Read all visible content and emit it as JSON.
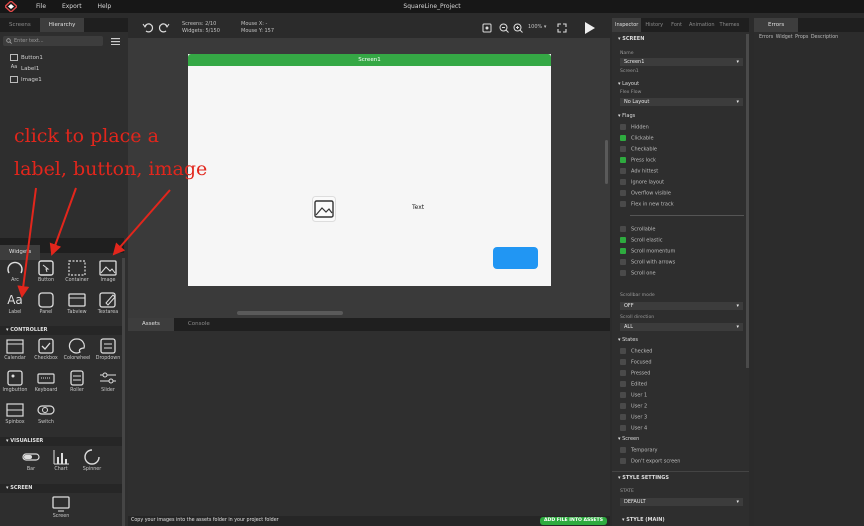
{
  "titlebar": {
    "menu": [
      "File",
      "Export",
      "Help"
    ],
    "title": "SquareLine_Project"
  },
  "left_tabs": [
    "Screens",
    "Hierarchy"
  ],
  "search": {
    "placeholder": "Enter text..."
  },
  "hierarchy": [
    {
      "icon": "button-icon",
      "label": "Button1"
    },
    {
      "icon": "label-icon",
      "label": "Label1"
    },
    {
      "icon": "image-icon",
      "label": "Image1"
    }
  ],
  "widgets_tab": "Widgets",
  "widgets_basic": [
    {
      "icon": "arc-icon",
      "label": "Arc"
    },
    {
      "icon": "button-icon",
      "label": "Button"
    },
    {
      "icon": "container-icon",
      "label": "Container"
    },
    {
      "icon": "image-icon",
      "label": "Image"
    },
    {
      "icon": "label-icon",
      "label": "Label"
    },
    {
      "icon": "panel-icon",
      "label": "Panel"
    },
    {
      "icon": "tabview-icon",
      "label": "Tabview"
    },
    {
      "icon": "textarea-icon",
      "label": "Textarea"
    }
  ],
  "section_controller": "CONTROLLER",
  "widgets_controller": [
    {
      "icon": "calendar-icon",
      "label": "Calendar"
    },
    {
      "icon": "checkbox-icon",
      "label": "Checkbox"
    },
    {
      "icon": "colorwheel-icon",
      "label": "Colorwheel"
    },
    {
      "icon": "dropdown-icon",
      "label": "Dropdown"
    },
    {
      "icon": "imgbutton-icon",
      "label": "Imgbutton"
    },
    {
      "icon": "keyboard-icon",
      "label": "Keyboard"
    },
    {
      "icon": "roller-icon",
      "label": "Roller"
    },
    {
      "icon": "slider-icon",
      "label": "Slider"
    },
    {
      "icon": "spinbox-icon",
      "label": "Spinbox"
    },
    {
      "icon": "switch-icon",
      "label": "Switch"
    }
  ],
  "section_visualiser": "VISUALISER",
  "widgets_visualiser": [
    {
      "icon": "bar-icon",
      "label": "Bar"
    },
    {
      "icon": "chart-icon",
      "label": "Chart"
    },
    {
      "icon": "spinner-icon",
      "label": "Spinner"
    }
  ],
  "section_screen": "SCREEN",
  "widgets_screen": [
    {
      "icon": "screen-icon",
      "label": "Screen"
    }
  ],
  "toolbar": {
    "screens": "Screens: 2/10",
    "widgets": "Widgets: 5/150",
    "mouse_x": "Mouse X: -",
    "mouse_y": "Mouse Y: 157",
    "zoom": "100%"
  },
  "canvas": {
    "screen_title": "Screen1",
    "label_text": "Text",
    "button_color": "#2196f3"
  },
  "bottom_tabs": [
    "Assets",
    "Console"
  ],
  "assets": {
    "hint": "Copy your images into the assets folder in your project folder",
    "add_button": "ADD FILE INTO ASSETS"
  },
  "inspector_tabs": [
    "Inspector",
    "History",
    "Font",
    "Animation",
    "Themes"
  ],
  "inspector": {
    "screen_head": "SCREEN",
    "name_label": "Name",
    "name_value": "Screen1",
    "name_sub": "Screen1",
    "layout_head": "Layout",
    "flex_flow_label": "Flex Flow",
    "flex_flow_value": "No Layout",
    "flags_head": "Flags",
    "flags": [
      {
        "label": "Hidden",
        "on": false
      },
      {
        "label": "Clickable",
        "on": true
      },
      {
        "label": "Checkable",
        "on": false
      },
      {
        "label": "Press lock",
        "on": true
      },
      {
        "label": "Adv hittest",
        "on": false
      },
      {
        "label": "Ignore layout",
        "on": false
      },
      {
        "label": "Overflow visible",
        "on": false
      },
      {
        "label": "Flex in new track",
        "on": false
      }
    ],
    "scroll_flags": [
      {
        "label": "Scrollable",
        "on": false
      },
      {
        "label": "Scroll elastic",
        "on": true
      },
      {
        "label": "Scroll momentum",
        "on": true
      },
      {
        "label": "Scroll with arrows",
        "on": false
      },
      {
        "label": "Scroll one",
        "on": false
      }
    ],
    "scrollbar_mode_label": "Scrollbar mode",
    "scrollbar_mode_value": "OFF",
    "scroll_direction_label": "Scroll direction",
    "scroll_direction_value": "ALL",
    "states_head": "States",
    "states": [
      "Checked",
      "Focused",
      "Pressed",
      "Edited",
      "User 1",
      "User 2",
      "User 3",
      "User 4"
    ],
    "screen_sub_head": "Screen",
    "screen_opts": [
      "Temporary",
      "Don't export screen"
    ],
    "style_head": "STYLE SETTINGS",
    "state_label": "STATE",
    "state_value": "DEFAULT",
    "style_main": "STYLE (MAIN)"
  },
  "errors": {
    "tab": "Errors",
    "columns": [
      "Errors",
      "Widget",
      "Props",
      "Description"
    ]
  },
  "annotation": {
    "line1": "click to place a",
    "line2": "label, button, image",
    "color": "#e2261c"
  }
}
